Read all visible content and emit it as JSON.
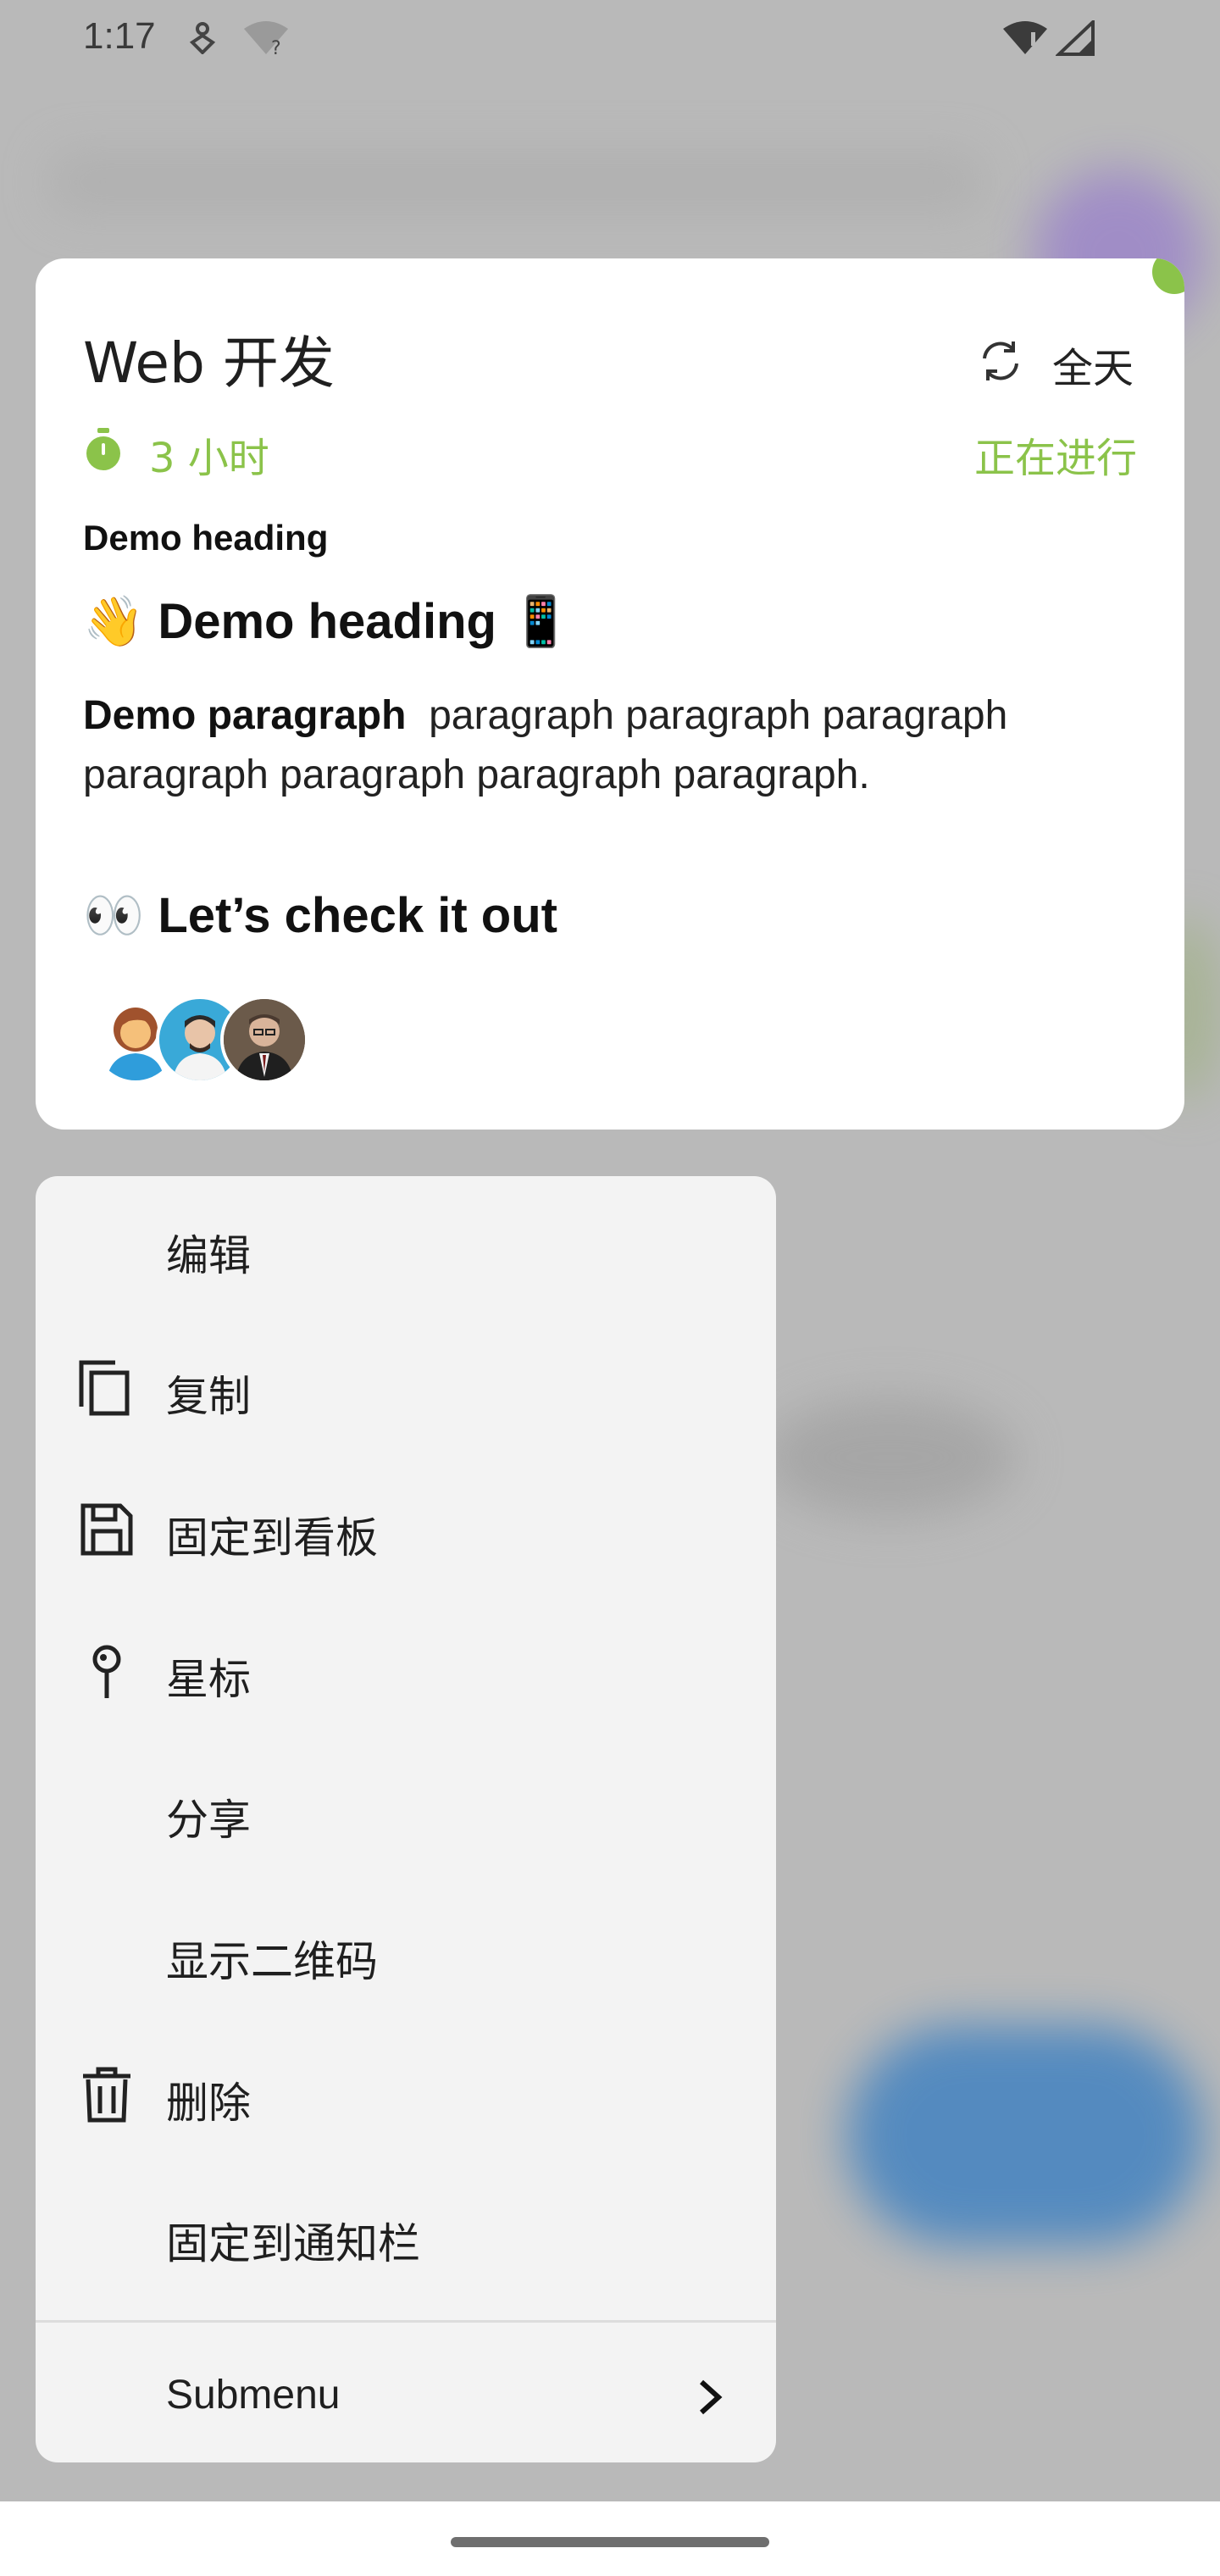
{
  "status_bar": {
    "time": "1:17"
  },
  "card": {
    "title": "Web 开发",
    "all_day_label": "全天",
    "duration": "3 小时",
    "status": "正在进行",
    "heading_small": "Demo heading",
    "heading_large": "👋 Demo heading 📱",
    "paragraph_bold": "Demo paragraph",
    "paragraph_text": "paragraph paragraph paragraph paragraph paragraph paragraph paragraph.",
    "check_heading": "👀 Let’s check it out",
    "accent_color": "#8bc34a",
    "avatars": [
      "woman-avatar",
      "man-avatar",
      "senior-man-avatar"
    ]
  },
  "menu": {
    "items": [
      {
        "label": "编辑",
        "icon": null
      },
      {
        "label": "复制",
        "icon": "copy-icon"
      },
      {
        "label": "固定到看板",
        "icon": "save-icon"
      },
      {
        "label": "星标",
        "icon": "pin-icon"
      },
      {
        "label": "分享",
        "icon": null
      },
      {
        "label": "显示二维码",
        "icon": null
      },
      {
        "label": "删除",
        "icon": "trash-icon"
      },
      {
        "label": "固定到通知栏",
        "icon": null
      }
    ],
    "submenu_label": "Submenu"
  }
}
